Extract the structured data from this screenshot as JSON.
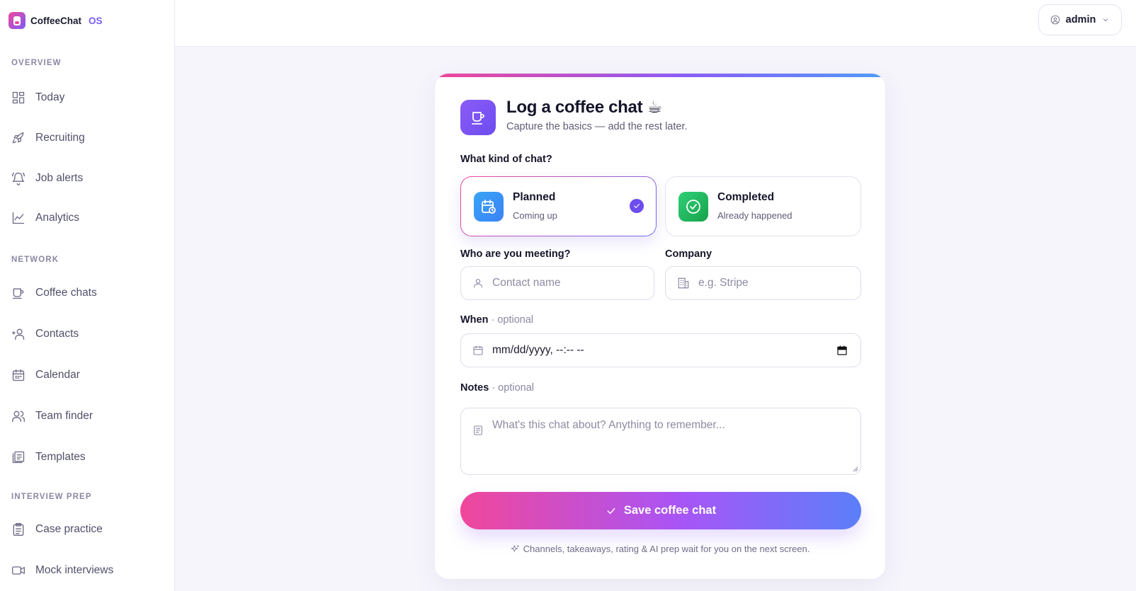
{
  "app": {
    "name": "CoffeeChat",
    "suffix": "OS"
  },
  "sidebar": {
    "sections": [
      {
        "label": "OVERVIEW"
      },
      {
        "label": "NETWORK"
      },
      {
        "label": "INTERVIEW PREP"
      }
    ],
    "items": [
      {
        "label": "Today",
        "icon": "dashboard-icon"
      },
      {
        "label": "Recruiting",
        "icon": "rocket-icon"
      },
      {
        "label": "Job alerts",
        "icon": "bell-icon"
      },
      {
        "label": "Analytics",
        "icon": "line-chart-icon"
      },
      {
        "label": "Coffee chats",
        "icon": "coffee-cup-icon"
      },
      {
        "label": "Contacts",
        "icon": "contacts-icon"
      },
      {
        "label": "Calendar",
        "icon": "calendar-icon"
      },
      {
        "label": "Team finder",
        "icon": "team-icon"
      },
      {
        "label": "Templates",
        "icon": "templates-icon"
      },
      {
        "label": "Case practice",
        "icon": "clipboard-icon"
      },
      {
        "label": "Mock interviews",
        "icon": "video-icon"
      }
    ]
  },
  "topbar": {
    "user": "admin"
  },
  "form": {
    "title": "Log a coffee chat ☕",
    "subtitle": "Capture the basics — add the rest later.",
    "kind_label": "What kind of chat?",
    "kinds": [
      {
        "title": "Planned",
        "subtitle": "Coming up",
        "selected": true
      },
      {
        "title": "Completed",
        "subtitle": "Already happened",
        "selected": false
      }
    ],
    "contact_label": "Who are you meeting?",
    "contact_placeholder": "Contact name",
    "company_label": "Company",
    "company_placeholder": "e.g. Stripe",
    "when_label": "When",
    "when_optional": "· optional",
    "when_value": "mm/dd/yyyy, --:-- --",
    "notes_label": "Notes",
    "notes_optional": "· optional",
    "notes_placeholder": "What's this chat about? Anything to remember...",
    "save_label": "Save coffee chat",
    "footnote": "Channels, takeaways, rating & AI prep wait for you on the next screen."
  },
  "colors": {
    "accent": "#6d4cf0",
    "pink": "#f0479b",
    "blue": "#4f9cf7",
    "green": "#16a34a"
  }
}
